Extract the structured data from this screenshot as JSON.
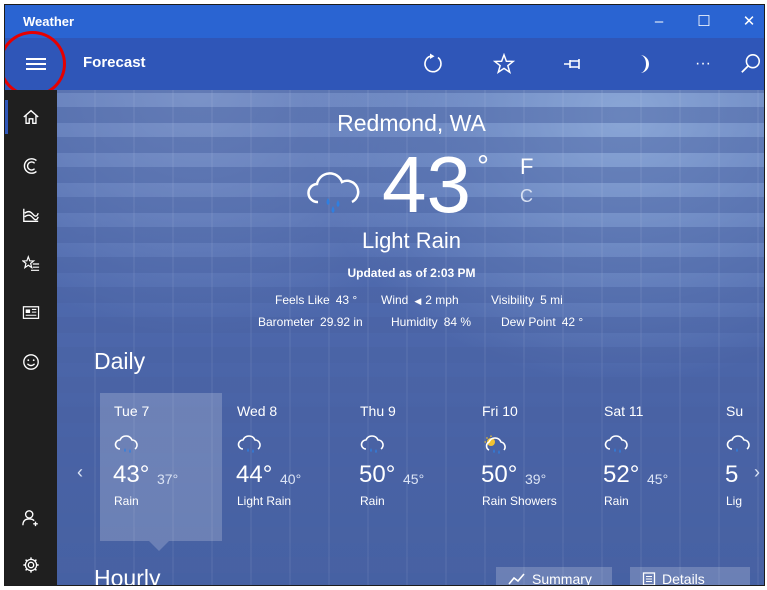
{
  "window": {
    "app_title": "Weather",
    "minimize": "–",
    "maximize": "☐",
    "close": "✕"
  },
  "toolbar": {
    "page_name": "Forecast",
    "icons": [
      "refresh-icon",
      "favorite-star-icon",
      "pin-icon",
      "dark-mode-moon-icon",
      "more-icon",
      "search-icon"
    ],
    "more_label": "···"
  },
  "sidebar": {
    "items": [
      "home-icon",
      "maps-icon",
      "historical-weather-icon",
      "favorites-icon",
      "news-icon",
      "feedback-icon"
    ],
    "bottom_items": [
      "account-icon",
      "settings-icon"
    ]
  },
  "current": {
    "city": "Redmond, WA",
    "temperature": "43",
    "degree_symbol": "°",
    "unit_f": "F",
    "unit_c": "C",
    "condition": "Light Rain",
    "updated": "Updated as of 2:03 PM",
    "details": {
      "feels_like_label": "Feels Like",
      "feels_like": "43 °",
      "wind_label": "Wind",
      "wind": "2 mph",
      "visibility_label": "Visibility",
      "visibility": "5 mi",
      "barometer_label": "Barometer",
      "barometer": "29.92 in",
      "humidity_label": "Humidity",
      "humidity": "84 %",
      "dew_point_label": "Dew Point",
      "dew_point": "42 °"
    }
  },
  "daily": {
    "heading": "Daily",
    "days": [
      {
        "name": "Tue 7",
        "hi": "43°",
        "lo": "37°",
        "cond": "Rain",
        "icon": "rain-cloud-icon"
      },
      {
        "name": "Wed 8",
        "hi": "44°",
        "lo": "40°",
        "cond": "Light Rain",
        "icon": "rain-cloud-icon"
      },
      {
        "name": "Thu 9",
        "hi": "50°",
        "lo": "45°",
        "cond": "Rain",
        "icon": "rain-cloud-icon"
      },
      {
        "name": "Fri 10",
        "hi": "50°",
        "lo": "39°",
        "cond": "Rain Showers",
        "icon": "sun-rain-icon"
      },
      {
        "name": "Sat 11",
        "hi": "52°",
        "lo": "45°",
        "cond": "Rain",
        "icon": "rain-cloud-icon"
      },
      {
        "name": "Su",
        "hi": "5",
        "lo": "",
        "cond": "Lig",
        "icon": "rain-cloud-icon"
      }
    ],
    "prev_arrow": "‹",
    "next_arrow": "›"
  },
  "hourly": {
    "heading": "Hourly",
    "summary_label": "Summary",
    "details_label": "Details"
  },
  "colors": {
    "titlebar": "#2a64d2",
    "toolbar": "#2f56b8",
    "sidebar": "#1f1f1f",
    "highlight_circle": "#e60000"
  }
}
